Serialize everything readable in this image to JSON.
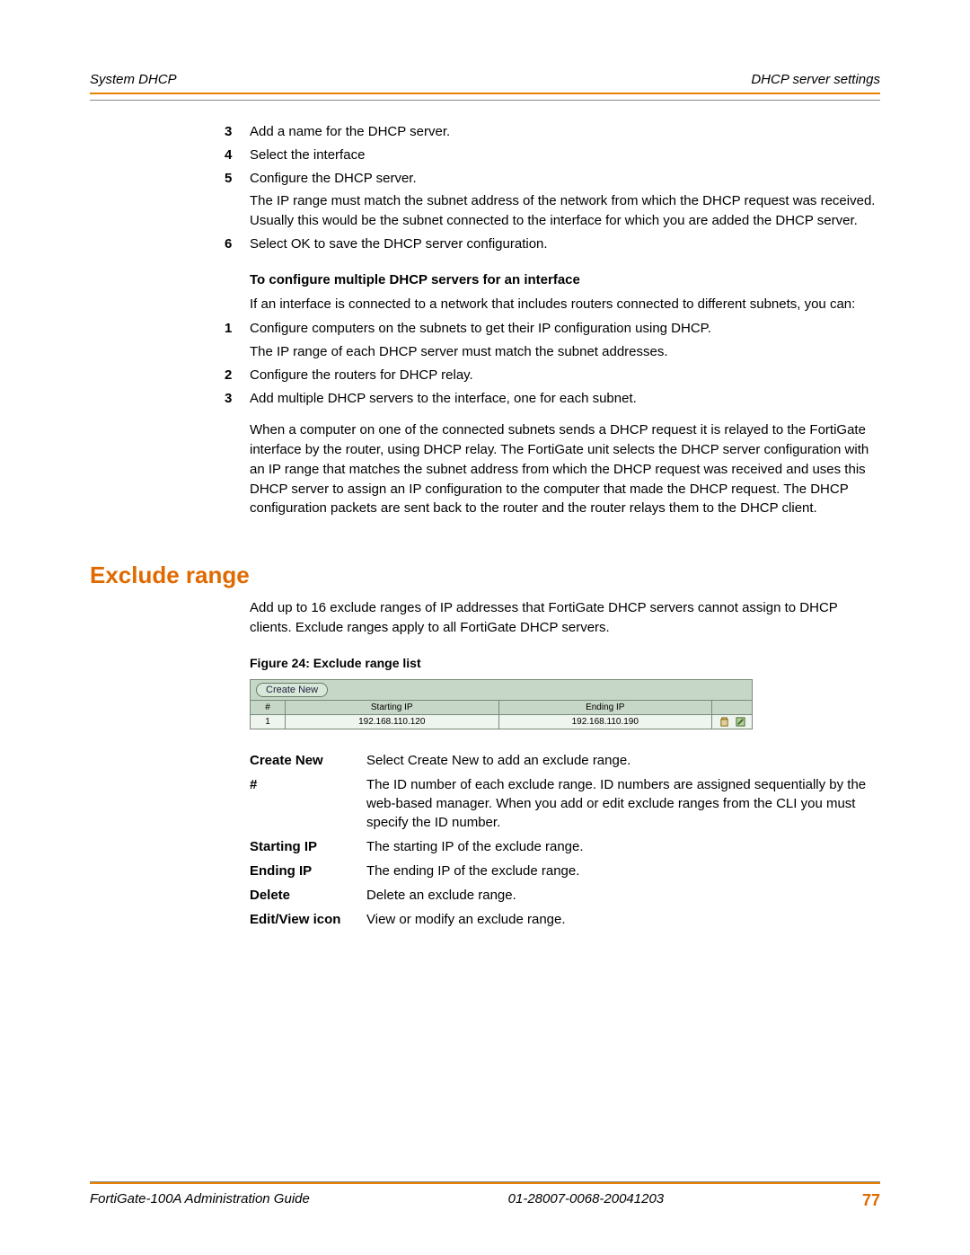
{
  "header": {
    "left": "System DHCP",
    "right": "DHCP server settings"
  },
  "steps_a": [
    {
      "n": "3",
      "text": "Add a name for the DHCP server."
    },
    {
      "n": "4",
      "text": "Select the interface"
    },
    {
      "n": "5",
      "text": "Configure the DHCP server.",
      "sub": "The IP range must match the subnet address of the network from which the DHCP request was received. Usually this would be the subnet connected to the interface for which you are added the DHCP server."
    },
    {
      "n": "6",
      "text": "Select OK to save the DHCP server configuration."
    }
  ],
  "sub_heading": "To configure multiple DHCP servers for an interface",
  "sub_intro": "If an interface is connected to a network that includes routers connected to different subnets, you can:",
  "steps_b": [
    {
      "n": "1",
      "text": "Configure computers on the subnets to get their IP configuration using DHCP.",
      "sub": "The IP range of each DHCP server must match the subnet addresses."
    },
    {
      "n": "2",
      "text": "Configure the routers for DHCP relay."
    },
    {
      "n": "3",
      "text": "Add multiple DHCP servers to the interface, one for each subnet."
    }
  ],
  "after_steps_para": "When a computer on one of the connected subnets sends a DHCP request it is relayed to the FortiGate interface by the router, using DHCP relay. The FortiGate unit selects the DHCP server configuration with an IP range that matches the subnet address from which the DHCP request was received and uses this DHCP server to assign an IP configuration to the computer that made the DHCP request. The DHCP configuration packets are sent back to the router and the router relays them to the DHCP client.",
  "section_title": "Exclude range",
  "section_intro": "Add up to 16 exclude ranges of IP addresses that FortiGate DHCP servers cannot assign to DHCP clients. Exclude ranges apply to all FortiGate DHCP servers.",
  "figure_caption": "Figure 24: Exclude range list",
  "shot": {
    "create_label": "Create New",
    "head_id": "#",
    "head_sip": "Starting IP",
    "head_eip": "Ending IP",
    "row_id": "1",
    "row_sip": "192.168.110.120",
    "row_eip": "192.168.110.190"
  },
  "defs": [
    {
      "term": "Create New",
      "desc": "Select Create New to add an exclude range."
    },
    {
      "term": "#",
      "desc": "The ID number of each exclude range. ID numbers are assigned sequentially by the web-based manager. When you add or edit exclude ranges from the CLI you must specify the ID number."
    },
    {
      "term": "Starting IP",
      "desc": "The starting IP of the exclude range."
    },
    {
      "term": "Ending IP",
      "desc": "The ending IP of the exclude range."
    },
    {
      "term": "Delete",
      "desc": "Delete an exclude range."
    },
    {
      "term": "Edit/View icon",
      "desc": "View or modify an exclude range."
    }
  ],
  "footer": {
    "left": "FortiGate-100A Administration Guide",
    "center": "01-28007-0068-20041203",
    "page": "77"
  }
}
